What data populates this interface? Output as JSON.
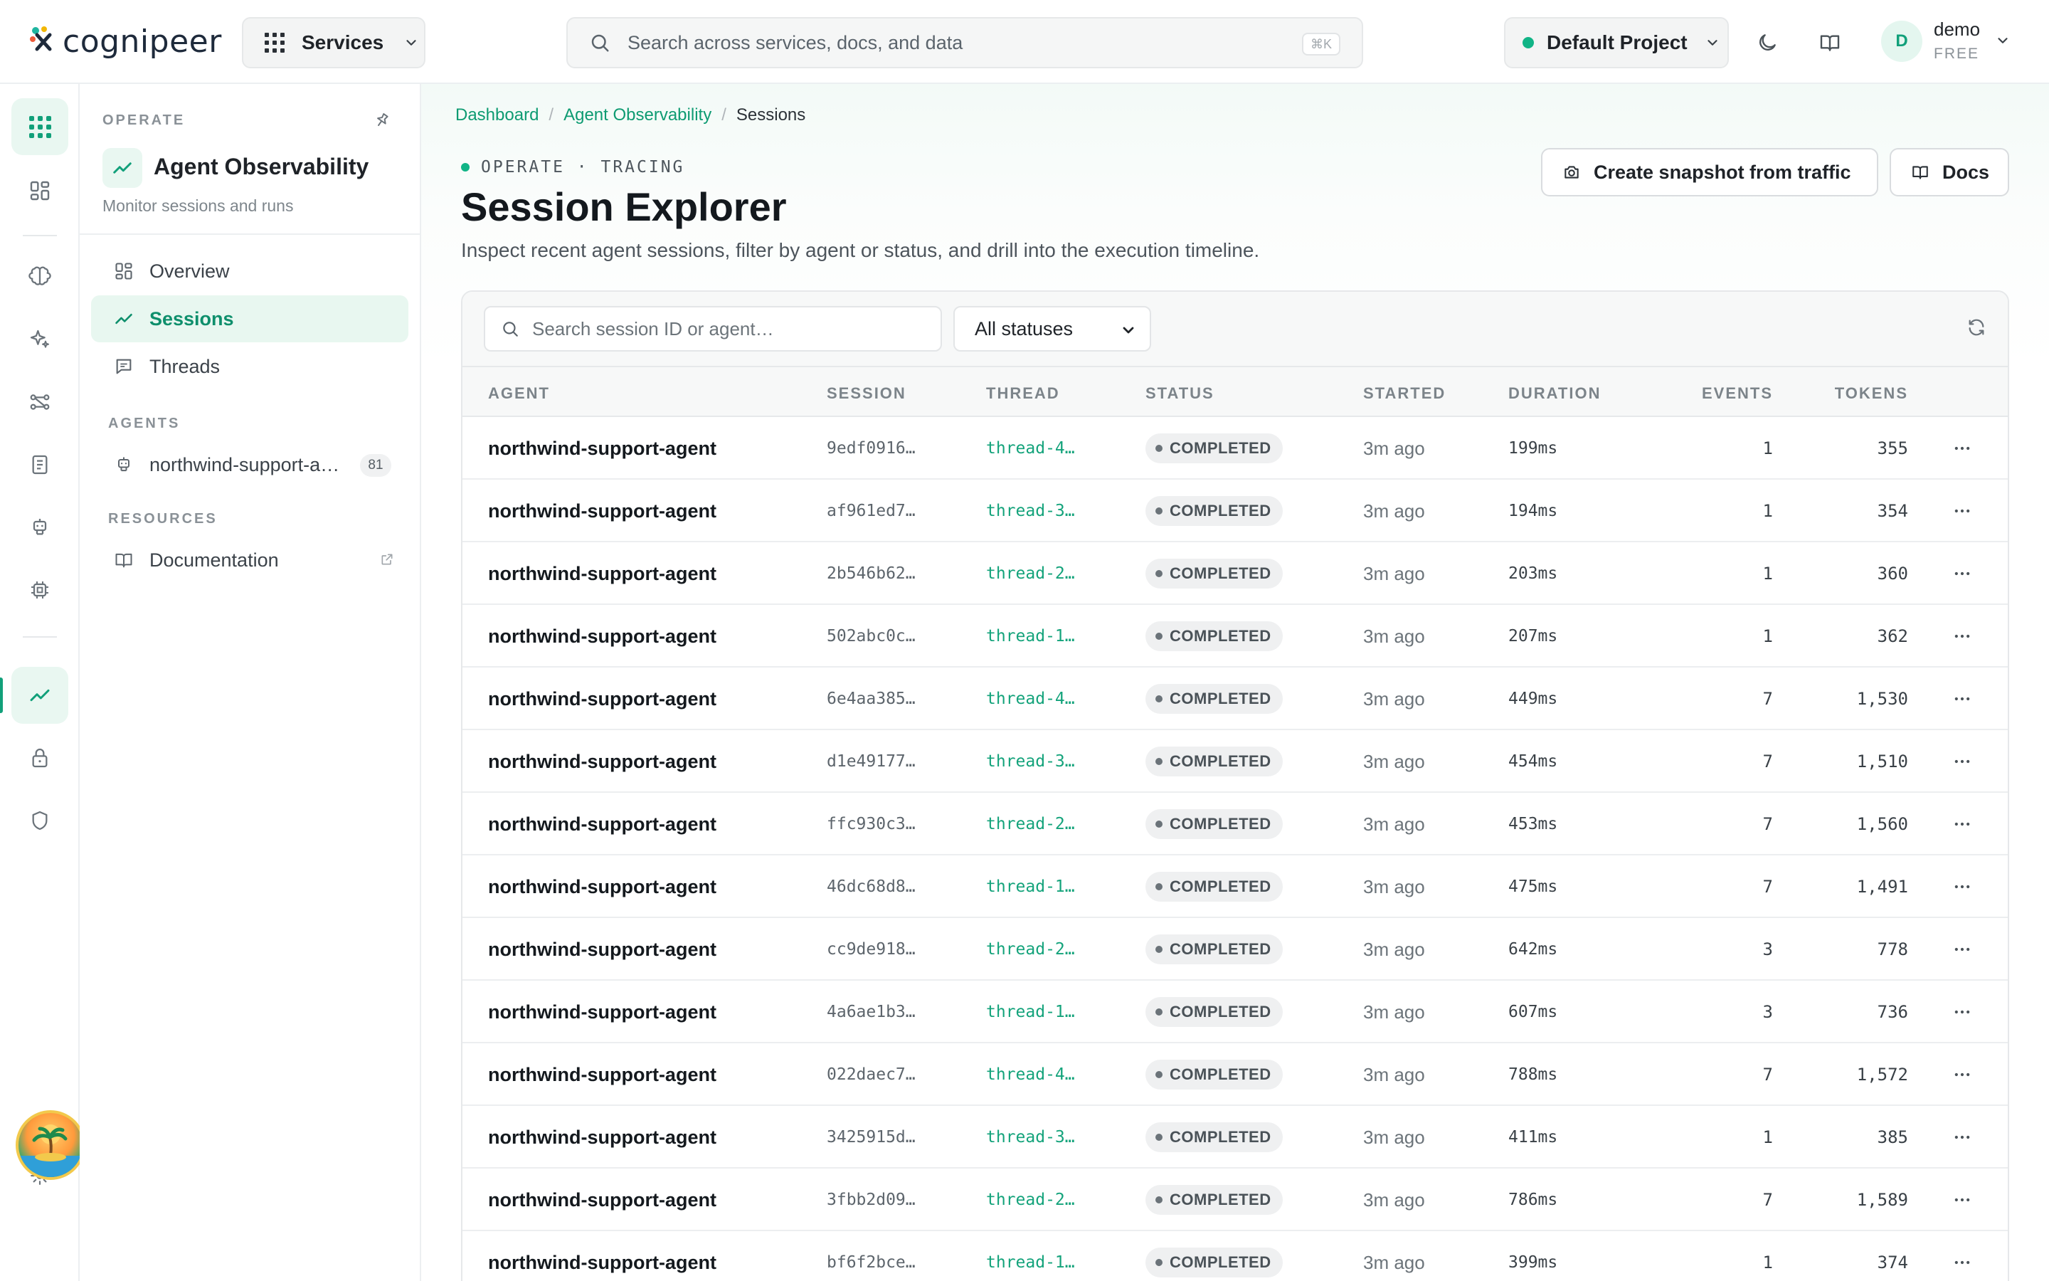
{
  "header": {
    "logo_text": "cognipeer",
    "services_label": "Services",
    "search_placeholder": "Search across services, docs, and data",
    "search_shortcut": "⌘K",
    "project_label": "Default Project",
    "user_initial": "D",
    "user_name": "demo",
    "user_plan": "FREE"
  },
  "panel": {
    "section_operate": "OPERATE",
    "app_title": "Agent Observability",
    "app_subtitle": "Monitor sessions and runs",
    "nav": [
      {
        "label": "Overview",
        "icon": "dashboard-icon"
      },
      {
        "label": "Sessions",
        "icon": "activity-icon"
      },
      {
        "label": "Threads",
        "icon": "message-icon"
      }
    ],
    "section_agents": "AGENTS",
    "agent_item": {
      "label": "northwind-support-a…",
      "count": "81"
    },
    "section_resources": "RESOURCES",
    "resource_item": {
      "label": "Documentation"
    }
  },
  "breadcrumb": {
    "items": [
      "Dashboard",
      "Agent Observability"
    ],
    "current": "Sessions",
    "separator": "/"
  },
  "page": {
    "eyebrow": "OPERATE · TRACING",
    "title": "Session Explorer",
    "description": "Inspect recent agent sessions, filter by agent or status, and drill into the execution timeline.",
    "snapshot_button": "Create snapshot from traffic",
    "docs_button": "Docs"
  },
  "filters": {
    "search_placeholder": "Search session ID or agent…",
    "status_selected": "All statuses"
  },
  "table": {
    "columns": [
      "AGENT",
      "SESSION",
      "THREAD",
      "STATUS",
      "STARTED",
      "DURATION",
      "EVENTS",
      "TOKENS"
    ],
    "rows": [
      {
        "agent": "northwind-support-agent",
        "session": "9edf0916…",
        "thread": "thread-4…",
        "status": "COMPLETED",
        "started": "3m ago",
        "duration": "199ms",
        "events": "1",
        "tokens": "355"
      },
      {
        "agent": "northwind-support-agent",
        "session": "af961ed7…",
        "thread": "thread-3…",
        "status": "COMPLETED",
        "started": "3m ago",
        "duration": "194ms",
        "events": "1",
        "tokens": "354"
      },
      {
        "agent": "northwind-support-agent",
        "session": "2b546b62…",
        "thread": "thread-2…",
        "status": "COMPLETED",
        "started": "3m ago",
        "duration": "203ms",
        "events": "1",
        "tokens": "360"
      },
      {
        "agent": "northwind-support-agent",
        "session": "502abc0c…",
        "thread": "thread-1…",
        "status": "COMPLETED",
        "started": "3m ago",
        "duration": "207ms",
        "events": "1",
        "tokens": "362"
      },
      {
        "agent": "northwind-support-agent",
        "session": "6e4aa385…",
        "thread": "thread-4…",
        "status": "COMPLETED",
        "started": "3m ago",
        "duration": "449ms",
        "events": "7",
        "tokens": "1,530"
      },
      {
        "agent": "northwind-support-agent",
        "session": "d1e49177…",
        "thread": "thread-3…",
        "status": "COMPLETED",
        "started": "3m ago",
        "duration": "454ms",
        "events": "7",
        "tokens": "1,510"
      },
      {
        "agent": "northwind-support-agent",
        "session": "ffc930c3…",
        "thread": "thread-2…",
        "status": "COMPLETED",
        "started": "3m ago",
        "duration": "453ms",
        "events": "7",
        "tokens": "1,560"
      },
      {
        "agent": "northwind-support-agent",
        "session": "46dc68d8…",
        "thread": "thread-1…",
        "status": "COMPLETED",
        "started": "3m ago",
        "duration": "475ms",
        "events": "7",
        "tokens": "1,491"
      },
      {
        "agent": "northwind-support-agent",
        "session": "cc9de918…",
        "thread": "thread-2…",
        "status": "COMPLETED",
        "started": "3m ago",
        "duration": "642ms",
        "events": "3",
        "tokens": "778"
      },
      {
        "agent": "northwind-support-agent",
        "session": "4a6ae1b3…",
        "thread": "thread-1…",
        "status": "COMPLETED",
        "started": "3m ago",
        "duration": "607ms",
        "events": "3",
        "tokens": "736"
      },
      {
        "agent": "northwind-support-agent",
        "session": "022daec7…",
        "thread": "thread-4…",
        "status": "COMPLETED",
        "started": "3m ago",
        "duration": "788ms",
        "events": "7",
        "tokens": "1,572"
      },
      {
        "agent": "northwind-support-agent",
        "session": "3425915d…",
        "thread": "thread-3…",
        "status": "COMPLETED",
        "started": "3m ago",
        "duration": "411ms",
        "events": "1",
        "tokens": "385"
      },
      {
        "agent": "northwind-support-agent",
        "session": "3fbb2d09…",
        "thread": "thread-2…",
        "status": "COMPLETED",
        "started": "3m ago",
        "duration": "786ms",
        "events": "7",
        "tokens": "1,589"
      },
      {
        "agent": "northwind-support-agent",
        "session": "bf6f2bce…",
        "thread": "thread-1…",
        "status": "COMPLETED",
        "started": "3m ago",
        "duration": "399ms",
        "events": "1",
        "tokens": "374"
      }
    ]
  },
  "colors": {
    "accent": "#11a07a",
    "accent_light": "#e8f7f0",
    "text_primary": "#14191e",
    "border": "#e6e8ea"
  }
}
